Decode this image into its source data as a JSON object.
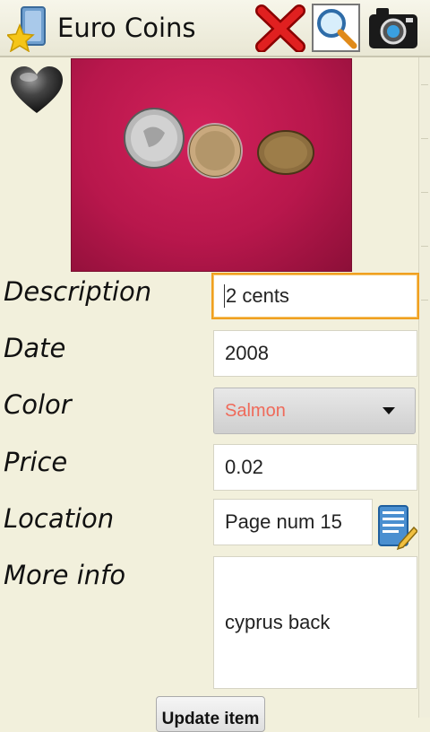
{
  "app": {
    "title": "Euro Coins",
    "icon": "folder-star-icon"
  },
  "toolbar": {
    "delete_icon": "close-x-icon",
    "search_icon": "magnifier-icon",
    "camera_icon": "camera-icon"
  },
  "item": {
    "favorite_icon": "heart-icon",
    "photo_subject": "coins-photo"
  },
  "form": {
    "description": {
      "label": "Description",
      "value": "2 cents"
    },
    "date": {
      "label": "Date",
      "value": "2008"
    },
    "color": {
      "label": "Color",
      "value": "Salmon"
    },
    "price": {
      "label": "Price",
      "value": "0.02"
    },
    "location": {
      "label": "Location",
      "value": "Page num 15"
    },
    "more_info": {
      "label": "More info",
      "value": "cyprus back"
    }
  },
  "actions": {
    "update_label": "Update item"
  },
  "colors": {
    "background": "#f2f0dc",
    "photo_bg": "#b8174c",
    "focus_border": "#f0a020",
    "color_value_text": "#ef6a5a"
  }
}
